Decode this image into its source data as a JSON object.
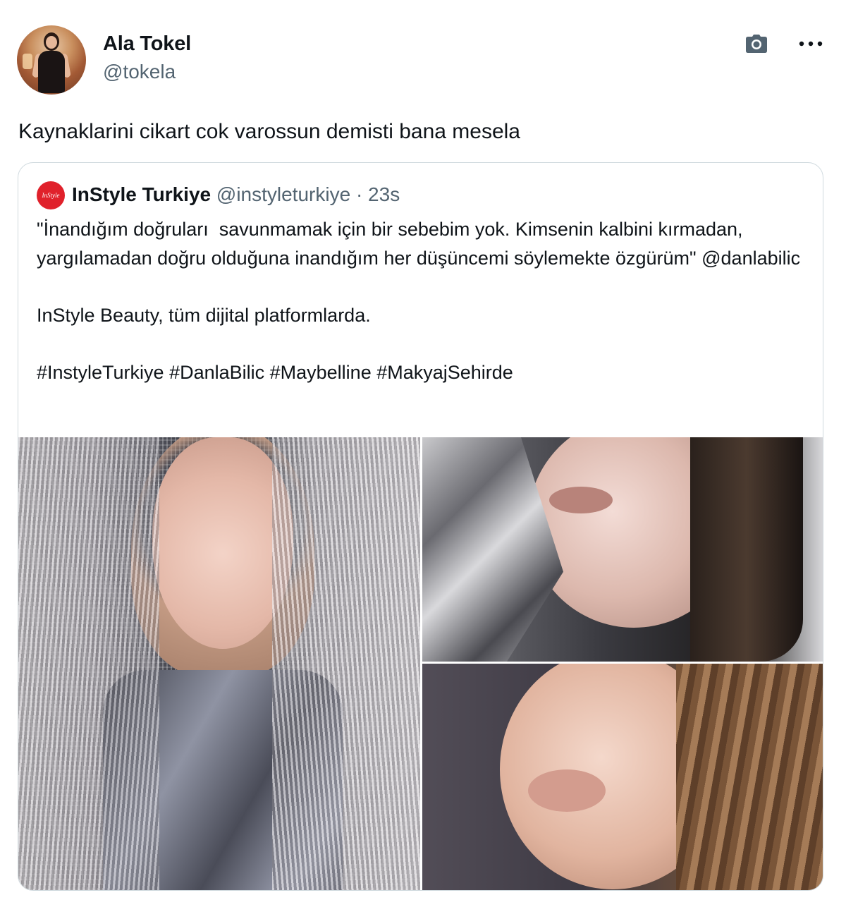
{
  "author": {
    "display_name": "Ala Tokel",
    "handle": "@tokela"
  },
  "tweet": {
    "text": "Kaynaklarini cikart cok varossun demisti bana mesela"
  },
  "quoted_tweet": {
    "avatar_text": "InStyle",
    "display_name": "InStyle Turkiye",
    "handle": "@instyleturkiye",
    "separator": "·",
    "time": "23s",
    "paragraphs": [
      "\"İnandığım doğruları  savunmamak için bir sebebim yok. Kimsenin kalbini kırmadan, yargılamadan doğru olduğuna inandığım her düşüncemi söylemekte özgürüm\" @danlabilic",
      "InStyle Beauty, tüm dijital platformlarda.",
      "#InstyleTurkiye #DanlaBilic #Maybelline #MakyajSehirde"
    ]
  },
  "icons": {
    "camera": "camera-icon",
    "more": "more-icon"
  },
  "colors": {
    "text": "#0f1419",
    "secondary": "#536471",
    "border": "#cfd9de",
    "instyle_red": "#e0212b"
  }
}
